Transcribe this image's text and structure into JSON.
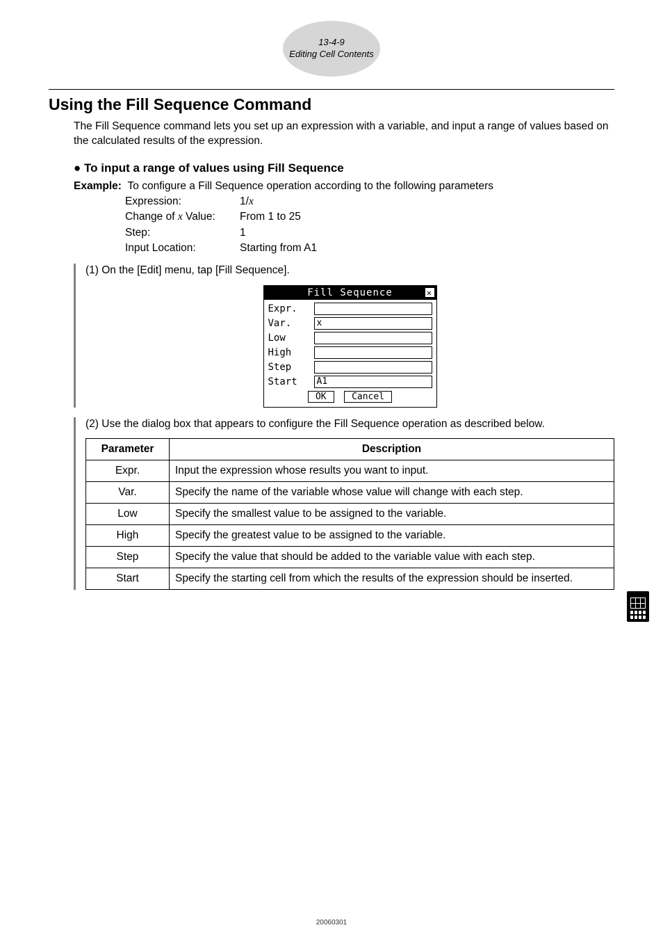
{
  "header": {
    "code": "13-4-9",
    "title": "Editing Cell Contents"
  },
  "section_title": "Using the Fill Sequence Command",
  "intro": "The Fill Sequence command lets you set up an expression with a variable, and input a range of values based on the calculated results of the expression.",
  "sub_heading_bullet": "●",
  "sub_heading": "To input a range of values using Fill Sequence",
  "example_label": "Example:",
  "example_text": "To configure a Fill Sequence operation according to the following parameters",
  "params": {
    "expression": {
      "k": "Expression:",
      "v_pre": "1/",
      "v_var": "x"
    },
    "change": {
      "k_pre": "Change of ",
      "k_var": "x",
      "k_post": " Value:",
      "v": "From 1 to 25"
    },
    "step": {
      "k": "Step:",
      "v": "1"
    },
    "input_loc": {
      "k": "Input Location:",
      "v": "Starting from A1"
    }
  },
  "step1": "(1) On the [Edit] menu, tap [Fill Sequence].",
  "dialog": {
    "title": "Fill Sequence",
    "close": "✕",
    "rows": [
      {
        "label": "Expr.",
        "value": ""
      },
      {
        "label": "Var.",
        "value": "x"
      },
      {
        "label": "Low",
        "value": ""
      },
      {
        "label": "High",
        "value": ""
      },
      {
        "label": "Step",
        "value": ""
      },
      {
        "label": "Start",
        "value": "A1"
      }
    ],
    "ok": "OK",
    "cancel": "Cancel"
  },
  "step2": "(2) Use the dialog box that appears to configure the Fill Sequence operation as described below.",
  "table": {
    "head": {
      "p": "Parameter",
      "d": "Description"
    },
    "rows": [
      {
        "p": "Expr.",
        "d": "Input the expression whose results you want to input."
      },
      {
        "p": "Var.",
        "d": "Specify the name of the variable whose value will change with each step."
      },
      {
        "p": "Low",
        "d": "Specify the smallest value to be assigned to the variable."
      },
      {
        "p": "High",
        "d": "Specify the greatest value to be assigned to the variable."
      },
      {
        "p": "Step",
        "d": "Specify the value that should be added to the variable value with each step."
      },
      {
        "p": "Start",
        "d": "Specify the starting cell from which the results of the expression should be inserted."
      }
    ]
  },
  "footer_date": "20060301"
}
